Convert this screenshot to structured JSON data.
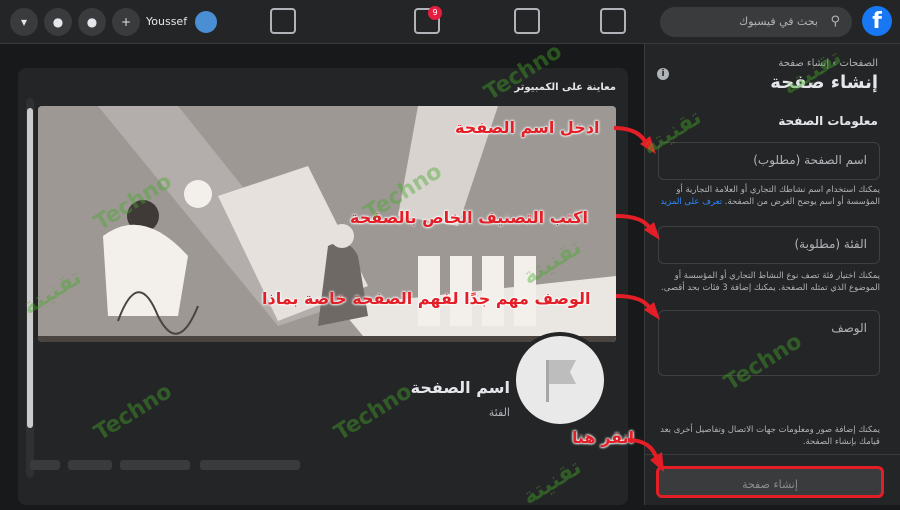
{
  "topbar": {
    "search_placeholder": "بحث في فيسبوك",
    "logo_letter": "f",
    "notif_count": "9",
    "user_name": "Youssef"
  },
  "sidebar": {
    "breadcrumb": "الصفحات › إنشاء صفحة",
    "title": "إنشاء صفحة",
    "section": "معلومات الصفحة",
    "name_placeholder": "اسم الصفحة (مطلوب)",
    "name_help": "يمكنك استخدام اسم نشاطك التجاري أو العلامة التجارية أو المؤسسة أو اسم يوضح الغرض من الصفحة.",
    "learn_more": "تعرف على المزيد",
    "category_placeholder": "الفئة (مطلوبة)",
    "category_help": "يمكنك اختيار فئة تصف نوع النشاط التجاري أو المؤسسة أو الموضوع الذي تمثله الصفحة. يمكنك إضافة 3 فئات بحد أقصى.",
    "desc_placeholder": "الوصف",
    "footer_help": "يمكنك إضافة صور ومعلومات جهات الاتصال وتفاصيل أخرى بعد قيامك بإنشاء الصفحة.",
    "create_button": "إنشاء صفحة"
  },
  "preview": {
    "title": "معاينة على الكمبيوتر",
    "page_name": "اسم الصفحة",
    "page_category": "الفئة"
  },
  "annotations": {
    "name_note": "ادخل اسم الصفحة",
    "category_note": "اكتب التصنيف الخاص بالصفحة",
    "desc_note": "الوصف مهم جدًا لفهم الصفحة خاصة بماذا",
    "click_note": "انقر هنا"
  },
  "watermark": {
    "latin": "Techno",
    "arabic": "تقنيتة"
  },
  "colors": {
    "accent": "#1877f2",
    "annotation": "#e41e26",
    "watermark": "#46aa28"
  }
}
